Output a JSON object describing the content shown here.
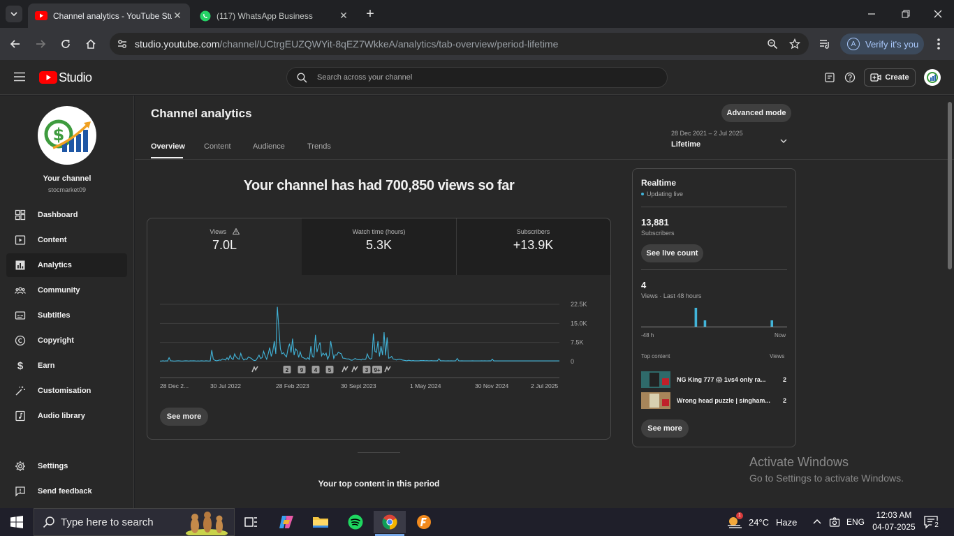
{
  "browser": {
    "tabs": [
      {
        "title": "Channel analytics - YouTube Stu",
        "active": true
      },
      {
        "title": "(117) WhatsApp Business",
        "active": false
      }
    ],
    "url_host": "studio.youtube.com",
    "url_path": "/channel/UCtrgEUZQWYit-8qEZ7WkkeA/analytics/tab-overview/period-lifetime",
    "verify_label": "Verify it's you",
    "verify_avatar": "A"
  },
  "studio": {
    "logo_label": "Studio",
    "search_placeholder": "Search across your channel",
    "create_label": "Create"
  },
  "sidebar": {
    "channel_title": "Your channel",
    "channel_handle": "stocmarket09",
    "items": [
      {
        "label": "Dashboard",
        "icon": "dashboard-icon"
      },
      {
        "label": "Content",
        "icon": "content-icon"
      },
      {
        "label": "Analytics",
        "icon": "analytics-icon"
      },
      {
        "label": "Community",
        "icon": "community-icon"
      },
      {
        "label": "Subtitles",
        "icon": "subtitles-icon"
      },
      {
        "label": "Copyright",
        "icon": "copyright-icon"
      },
      {
        "label": "Earn",
        "icon": "dollar-icon"
      },
      {
        "label": "Customisation",
        "icon": "magic-wand-icon"
      },
      {
        "label": "Audio library",
        "icon": "audio-library-icon"
      }
    ],
    "settings_label": "Settings",
    "feedback_label": "Send feedback"
  },
  "main": {
    "title": "Channel analytics",
    "advanced_mode_label": "Advanced mode",
    "tabs": [
      "Overview",
      "Content",
      "Audience",
      "Trends"
    ],
    "period_range": "28 Dec 2021 – 2 Jul 2025",
    "period_label": "Lifetime",
    "headline": "Your channel has had 700,850 views so far",
    "metrics": [
      {
        "label": "Views",
        "value": "7.0L"
      },
      {
        "label": "Watch time (hours)",
        "value": "5.3K"
      },
      {
        "label": "Subscribers",
        "value": "+13.9K"
      }
    ],
    "see_more_label": "See more",
    "top_content_heading": "Your top content in this period"
  },
  "chart_data": {
    "type": "line",
    "y_ticks": [
      "22.5K",
      "15.0K",
      "7.5K",
      "0"
    ],
    "ylim": [
      0,
      22500
    ],
    "x_tick_labels": [
      "28 Dec 2...",
      "30 Jul 2022",
      "28 Feb 2023",
      "30 Sept 2023",
      "1 May 2024",
      "30 Nov 2024",
      "2 Jul 2025"
    ],
    "series": [
      {
        "values": [
          200,
          200,
          300,
          200,
          300,
          200,
          1500,
          300,
          250,
          200,
          200,
          250,
          300,
          250,
          200,
          200,
          250,
          300,
          250,
          200,
          300,
          250,
          300,
          250,
          200,
          250,
          200,
          300,
          250,
          200,
          300,
          250,
          200,
          250,
          4500,
          900,
          500,
          300,
          400,
          600,
          500,
          1000,
          800,
          600,
          1500,
          700,
          2400,
          1200,
          800,
          3000,
          1800,
          1200,
          900,
          3200,
          1500,
          600,
          1000,
          800,
          1800,
          1500,
          1200,
          600,
          400,
          500,
          1500,
          2500,
          1200,
          1500,
          4000,
          2200,
          900,
          3000,
          5500,
          2000,
          4000,
          8000,
          3000,
          21500,
          13000,
          5000,
          3000,
          3500,
          2500,
          1800,
          5000,
          7000,
          3500,
          9000,
          2500,
          5000,
          4200,
          1600,
          3800,
          1800,
          1500,
          1200,
          900,
          1500,
          800,
          6000,
          2000,
          1700,
          10500,
          3700,
          6000,
          7500,
          2200,
          3300,
          2500,
          3300,
          900,
          2300,
          8000,
          4400,
          1200,
          2600,
          2500,
          3700,
          3300,
          3000,
          1300,
          1300,
          1100,
          1000,
          1000,
          600,
          500,
          800,
          1200,
          900,
          700,
          800,
          600,
          1000,
          800,
          900,
          3000,
          1500,
          1000,
          1200,
          11000,
          4000,
          3600,
          8000,
          2000,
          6000,
          2500,
          11500,
          2400,
          9500,
          1300,
          1500,
          2000,
          1000,
          900,
          600,
          800,
          900,
          800,
          600,
          500,
          400,
          300,
          500,
          400,
          300,
          400,
          300,
          300,
          300,
          300,
          400,
          350,
          400,
          300,
          350,
          300,
          300,
          350,
          300,
          300,
          300,
          300,
          1100,
          300,
          300,
          300,
          250,
          250,
          300,
          250,
          300,
          250,
          250,
          300,
          1200,
          300,
          250,
          300,
          250,
          250,
          250,
          250,
          250,
          250,
          300,
          250,
          250,
          250,
          250,
          250,
          300,
          250,
          300,
          250,
          250,
          300,
          250,
          900,
          250,
          250,
          250,
          250,
          250,
          250,
          250,
          250,
          250,
          250,
          250,
          250,
          250,
          250,
          250,
          250,
          250,
          250,
          250,
          250,
          250,
          250,
          250,
          250,
          250,
          250,
          250,
          250,
          250,
          250,
          250,
          250,
          250,
          250,
          250,
          250,
          250,
          250,
          250,
          250,
          250,
          250,
          250,
          250
        ]
      }
    ],
    "markers": [
      "2",
      "9",
      "4",
      "5",
      "3",
      "9+"
    ]
  },
  "realtime": {
    "title": "Realtime",
    "status": "Updating live",
    "subscribers_value": "13,881",
    "subscribers_label": "Subscribers",
    "live_count_label": "See live count",
    "views_value": "4",
    "views_label": "Views · Last 48 hours",
    "axis_start": "-48 h",
    "axis_end": "Now",
    "bars": [
      {
        "hour_offset": -30,
        "views": 3
      },
      {
        "hour_offset": -27,
        "views": 1
      },
      {
        "hour_offset": -5,
        "views": 1
      }
    ],
    "top_content_label": "Top content",
    "views_col_label": "Views",
    "top_content": [
      {
        "title": "NG King 777 😱 1vs4 only ra...",
        "views": "2"
      },
      {
        "title": "Wrong head puzzle | singham...",
        "views": "2"
      }
    ],
    "see_more_label": "See more"
  },
  "watermark": {
    "line1": "Activate Windows",
    "line2": "Go to Settings to activate Windows."
  },
  "taskbar": {
    "search_placeholder": "Type here to search",
    "weather_temp": "24°C",
    "weather_desc": "Haze",
    "weather_badge": "1",
    "language": "ENG",
    "time": "12:03 AM",
    "date": "04-07-2025",
    "notification_count": "2"
  }
}
